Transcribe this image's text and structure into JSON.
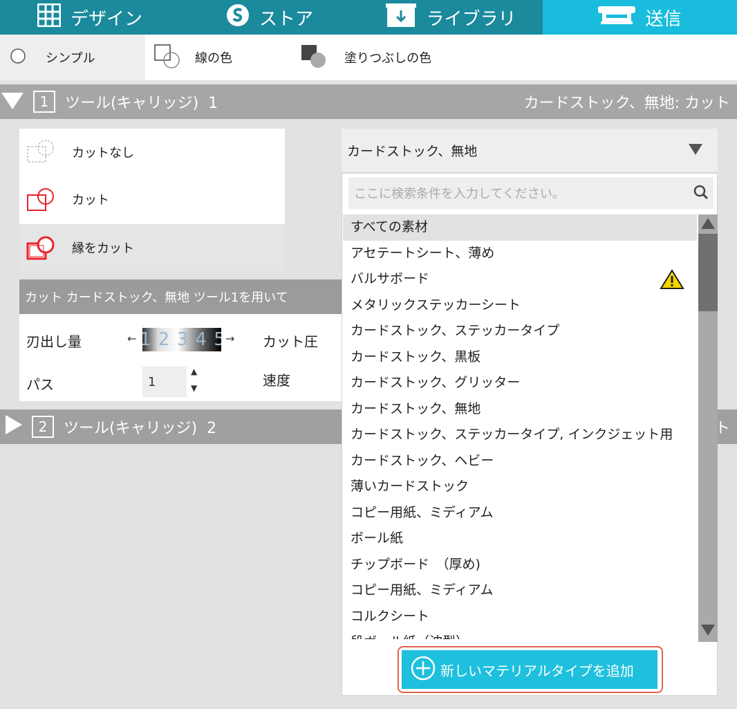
{
  "nav": {
    "tabs": [
      {
        "label": "デザイン",
        "icon": "grid-icon"
      },
      {
        "label": "ストア",
        "icon": "silhouette-s-icon"
      },
      {
        "label": "ライブラリ",
        "icon": "library-download-icon"
      },
      {
        "label": "送信",
        "icon": "cutter-machine-icon"
      }
    ],
    "active_index": 3
  },
  "modes": {
    "simple": "シンプル",
    "line_color": "線の色",
    "fill_color": "塗りつぶしの色"
  },
  "tool1": {
    "number": "1",
    "label": "ツール(キャリッジ)  1",
    "summary": "カードストック、無地: カット"
  },
  "tool2": {
    "number": "2",
    "label": "ツール(キャリッジ)  2",
    "summary_fragment": "ト"
  },
  "cut_options": {
    "no_cut": "カットなし",
    "cut": "カット",
    "cut_edge": "縁をカット",
    "selected": "cut_edge"
  },
  "settings": {
    "header": "カット カードストック、無地 ツール1を用いて",
    "blade_label": "刃出し量",
    "blade_digits": "1 2 3 4 5",
    "pressure_label": "カット圧",
    "passes_label": "パス",
    "passes_value": "1",
    "speed_label": "速度"
  },
  "material": {
    "selected": "カードストック、無地",
    "search_placeholder": "ここに検索条件を入力してください。",
    "items": [
      "すべての素材",
      "アセテートシート、薄め",
      "バルサボード",
      "メタリックステッカーシート",
      "カードストック、ステッカータイプ",
      "カードストック、黒板",
      "カードストック、グリッター",
      "カードストック、無地",
      "カードストック、ステッカータイプ, インクジェット用",
      "カードストック、ヘビー",
      "薄いカードストック",
      "コピー用紙、ミディアム",
      "ボール紙",
      "チップボード　（厚め)",
      "コピー用紙、ミディアム",
      "コルクシート",
      "段ボール紙（波型）"
    ],
    "warning_item_index": 2,
    "add_button": "新しいマテリアルタイプを追加"
  },
  "colors": {
    "nav_bg": "#1a8a9c",
    "nav_active": "#19bcdc",
    "accent_red": "#e8232a",
    "add_button": "#1fc0de",
    "highlight_border": "#e2624f"
  }
}
